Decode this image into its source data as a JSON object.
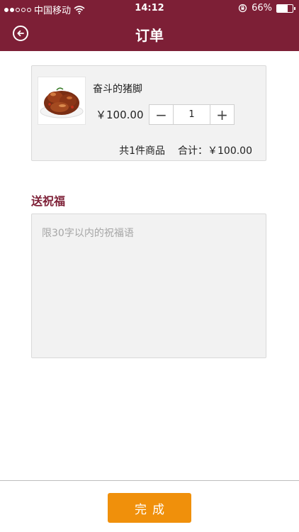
{
  "status_bar": {
    "carrier": "中国移动",
    "time": "14:12",
    "battery": "66%",
    "battery_level": 0.66
  },
  "nav": {
    "title": "订单",
    "back_icon": "back-circle-icon"
  },
  "order": {
    "product_name": "奋斗的猪脚",
    "price": "￥100.00",
    "quantity": "1",
    "minus_label": "−",
    "plus_label": "+",
    "count_text": "共1件商品",
    "total_text": "合计：￥100.00"
  },
  "blessing": {
    "title": "送祝福",
    "placeholder": "限30字以内的祝福语"
  },
  "footer": {
    "done_label": "完成"
  },
  "colors": {
    "brand": "#7d1f36",
    "accent": "#f0900b"
  }
}
